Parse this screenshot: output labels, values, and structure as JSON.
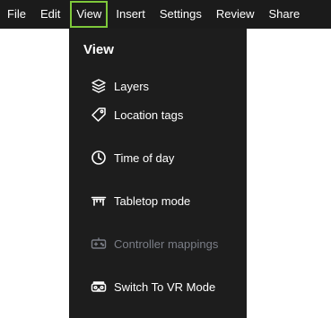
{
  "menubar": {
    "items": [
      {
        "label": "File"
      },
      {
        "label": "Edit"
      },
      {
        "label": "View"
      },
      {
        "label": "Insert"
      },
      {
        "label": "Settings"
      },
      {
        "label": "Review"
      },
      {
        "label": "Share"
      }
    ],
    "active_item": "View",
    "active_outline_color": "#7ec83a"
  },
  "view_menu": {
    "title": "View",
    "items": [
      {
        "label": "Layers",
        "icon": "layers-icon",
        "enabled": true
      },
      {
        "label": "Location tags",
        "icon": "tag-icon",
        "enabled": true
      },
      {
        "label": "Time of day",
        "icon": "clock-icon",
        "enabled": true
      },
      {
        "label": "Tabletop mode",
        "icon": "table-icon",
        "enabled": true
      },
      {
        "label": "Controller mappings",
        "icon": "controller-icon",
        "enabled": false
      },
      {
        "label": "Switch To VR Mode",
        "icon": "vr-headset-icon",
        "enabled": true
      }
    ]
  },
  "colors": {
    "menubar_background": "#1b1b1b",
    "menu_background": "#1d1d1d",
    "text": "#ffffff",
    "disabled_text": "#7a7d86"
  }
}
